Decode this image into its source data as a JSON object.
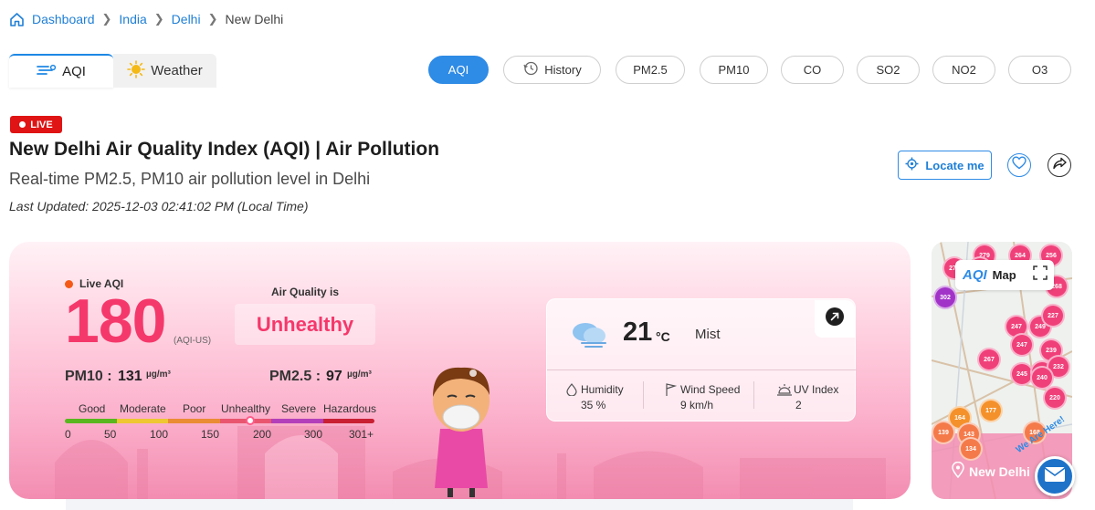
{
  "breadcrumb": {
    "items": [
      {
        "label": "Dashboard",
        "icon": "home-icon"
      },
      {
        "label": "India"
      },
      {
        "label": "Delhi"
      },
      {
        "label": "New Delhi"
      }
    ]
  },
  "mode_tabs": [
    {
      "label": "AQI",
      "icon": "aqi-wind-icon",
      "active": true
    },
    {
      "label": "Weather",
      "icon": "sun-icon",
      "active": false
    }
  ],
  "pollutant_tabs": [
    {
      "label": "AQI",
      "active": true
    },
    {
      "label": "History",
      "icon": "history-icon"
    },
    {
      "label": "PM2.5"
    },
    {
      "label": "PM10"
    },
    {
      "label": "CO"
    },
    {
      "label": "SO2"
    },
    {
      "label": "NO2"
    },
    {
      "label": "O3"
    }
  ],
  "header": {
    "live_badge": "LIVE",
    "title": "New Delhi Air Quality Index (AQI) | Air Pollution",
    "subtitle": "Real-time PM2.5, PM10 air pollution level in Delhi",
    "last_updated": "Last Updated: 2025-12-03 02:41:02 PM (Local Time)",
    "locate_label": "Locate me"
  },
  "aqi": {
    "live_label": "Live AQI",
    "value": "180",
    "unit": "(AQI-US)",
    "air_quality_is": "Air Quality is",
    "status": "Unhealthy",
    "pm10_label": "PM10 :",
    "pm10_value": "131",
    "pm10_unit": "µg/m³",
    "pm25_label": "PM2.5 :",
    "pm25_value": "97",
    "pm25_unit": "µg/m³",
    "scale_labels": [
      "Good",
      "Moderate",
      "Poor",
      "Unhealthy",
      "Severe",
      "Hazardous"
    ],
    "scale_numbers": [
      "0",
      "50",
      "100",
      "150",
      "200",
      "300",
      "301+"
    ],
    "scale_colors": [
      "#59b61f",
      "#eec732",
      "#ea8c34",
      "#e9556f",
      "#b33fba",
      "#c92033"
    ],
    "marker_value": 180
  },
  "weather": {
    "temperature": "21",
    "temp_unit": "°C",
    "condition": "Mist",
    "humidity_label": "Humidity",
    "humidity_value": "35 %",
    "wind_label": "Wind Speed",
    "wind_value": "9 km/h",
    "uv_label": "UV Index",
    "uv_value": "2"
  },
  "map": {
    "logo": "AQI",
    "label": "Map",
    "city": "New Delhi",
    "overlay_text": "We Are Here!",
    "bubbles": [
      "279",
      "264",
      "256",
      "270",
      "257",
      "268",
      "302",
      "247",
      "249",
      "227",
      "247",
      "239",
      "267",
      "245",
      "261",
      "232",
      "240",
      "220",
      "164",
      "177",
      "139",
      "143",
      "168",
      "134"
    ]
  }
}
